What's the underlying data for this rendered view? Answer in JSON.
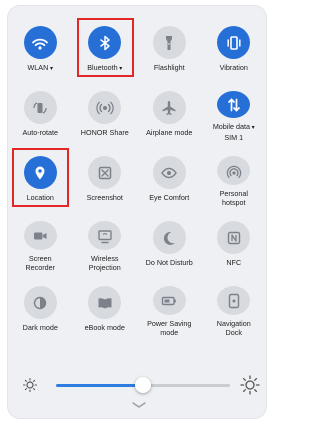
{
  "tiles": [
    {
      "id": "wlan",
      "label": "WLAN",
      "dropdown": true,
      "on": true,
      "icon": "wifi-icon"
    },
    {
      "id": "bluetooth",
      "label": "Bluetooth",
      "dropdown": true,
      "on": true,
      "icon": "bluetooth-icon",
      "highlighted": true
    },
    {
      "id": "flashlight",
      "label": "Flashlight",
      "on": false,
      "icon": "flashlight-icon"
    },
    {
      "id": "vibration",
      "label": "Vibration",
      "on": true,
      "icon": "vibration-icon"
    },
    {
      "id": "auto-rotate",
      "label": "Auto-rotate",
      "on": false,
      "icon": "auto-rotate-icon"
    },
    {
      "id": "honor-share",
      "label": "HONOR Share",
      "on": false,
      "icon": "honor-share-icon"
    },
    {
      "id": "airplane-mode",
      "label": "Airplane mode",
      "on": false,
      "icon": "airplane-icon"
    },
    {
      "id": "mobile-data",
      "label": "Mobile data",
      "dropdown": true,
      "label2": "SIM 1",
      "on": true,
      "icon": "mobile-data-icon"
    },
    {
      "id": "location",
      "label": "Location",
      "on": true,
      "icon": "location-icon",
      "highlighted": true
    },
    {
      "id": "screenshot",
      "label": "Screenshot",
      "on": false,
      "icon": "screenshot-icon"
    },
    {
      "id": "eye-comfort",
      "label": "Eye Comfort",
      "on": false,
      "icon": "eye-icon"
    },
    {
      "id": "personal-hotspot",
      "label": "Personal",
      "label2": "hotspot",
      "on": false,
      "icon": "hotspot-icon"
    },
    {
      "id": "screen-recorder",
      "label": "Screen",
      "label2": "Recorder",
      "on": false,
      "icon": "screen-recorder-icon"
    },
    {
      "id": "wireless-projection",
      "label": "Wireless",
      "label2": "Projection",
      "on": false,
      "icon": "projection-icon"
    },
    {
      "id": "do-not-disturb",
      "label": "Do Not Disturb",
      "on": false,
      "icon": "moon-icon"
    },
    {
      "id": "nfc",
      "label": "NFC",
      "on": false,
      "icon": "nfc-icon"
    },
    {
      "id": "dark-mode",
      "label": "Dark mode",
      "on": false,
      "icon": "dark-mode-icon"
    },
    {
      "id": "ebook-mode",
      "label": "eBook mode",
      "on": false,
      "icon": "ebook-icon"
    },
    {
      "id": "power-saving-mode",
      "label": "Power Saving",
      "label2": "mode",
      "on": false,
      "icon": "battery-icon"
    },
    {
      "id": "navigation-dock",
      "label": "Navigation",
      "label2": "Dock",
      "on": false,
      "icon": "navigation-dock-icon"
    }
  ],
  "brightness": {
    "level": 0.5
  },
  "colors": {
    "accent": "#256fd7",
    "highlight": "#e32626",
    "tile_off": "#d7dadf",
    "panel": "#eef0f3"
  }
}
